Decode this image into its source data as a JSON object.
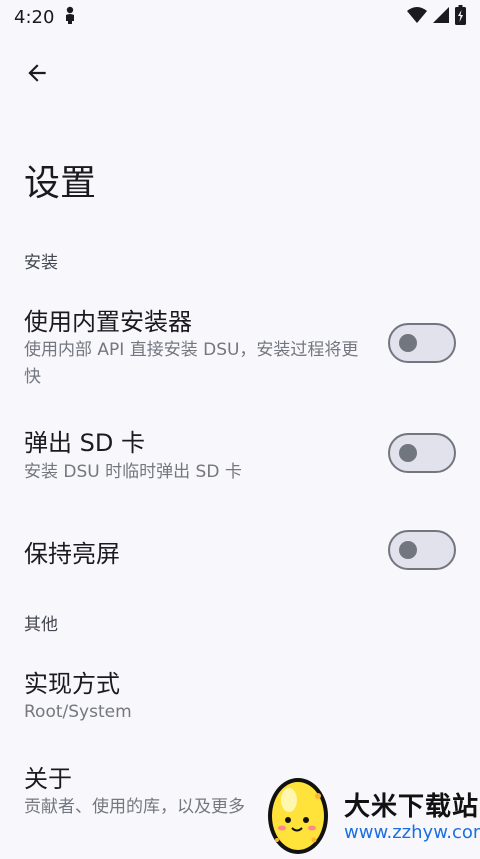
{
  "status_bar": {
    "time": "4:20",
    "icons": [
      "person-icon",
      "wifi-icon",
      "signal-icon",
      "battery-charging-icon"
    ]
  },
  "toolbar": {
    "back_icon": "arrow-back-icon"
  },
  "page": {
    "title": "设置"
  },
  "sections": [
    {
      "header": "安装",
      "items": [
        {
          "title": "使用内置安装器",
          "summary": "使用内部 API 直接安装 DSU，安装过程将更快",
          "switch_on": false
        },
        {
          "title": "弹出 SD 卡",
          "summary": "安装 DSU 时临时弹出 SD 卡",
          "switch_on": false
        },
        {
          "title": "保持亮屏",
          "summary": "",
          "switch_on": false
        }
      ]
    },
    {
      "header": "其他",
      "items": [
        {
          "title": "实现方式",
          "summary": "Root/System"
        },
        {
          "title": "关于",
          "summary": "贡献者、使用的库，以及更多"
        }
      ]
    }
  ],
  "watermark": {
    "name": "大米下载站",
    "url": "www.zzhyw.com"
  },
  "colors": {
    "background": "#f8f8fc",
    "switch_track": "#e1e2ec",
    "switch_outline": "#72767e",
    "watermark_url": "#1d6fe0"
  }
}
